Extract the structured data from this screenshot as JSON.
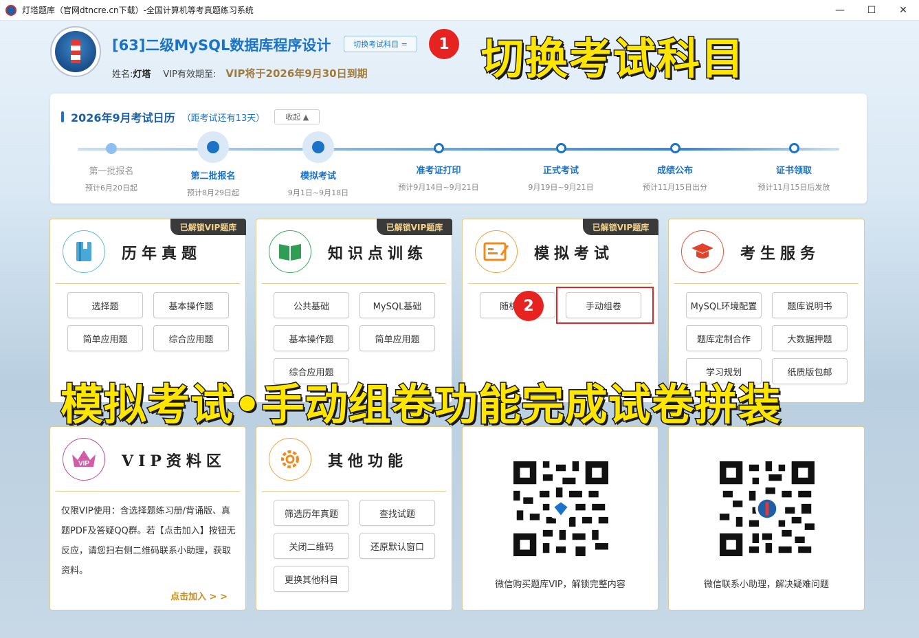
{
  "window": {
    "title": "灯塔题库（官网dtncre.cn下载）-全国计算机等考真题练习系统",
    "minimize": "—",
    "maximize": "☐",
    "close": "✕"
  },
  "header": {
    "subject": "[63]二级MySQL数据库程序设计",
    "switch_label": "切换考试科目 =",
    "name_label": "姓名:",
    "name": "灯塔",
    "vip_label": "VIP有效期至:",
    "vip_expire": "VIP将于2026年9月30日到期"
  },
  "annotations": {
    "badge1": "1",
    "badge2": "2",
    "overlay_top": "切换考试科目",
    "overlay_mid": "模拟考试•手动组卷功能完成试卷拼装"
  },
  "calendar": {
    "title": "2026年9月考试日历",
    "remain": "（距考试还有13天）",
    "collapse": "收起 ▲",
    "steps": [
      {
        "name": "第一批报名",
        "date": "预计6月20日起"
      },
      {
        "name": "第二批报名",
        "date": "预计8月29日起"
      },
      {
        "name": "模拟考试",
        "date": "9月1日~9月18日"
      },
      {
        "name": "准考证打印",
        "date": "预计9月14日~9月21日"
      },
      {
        "name": "正式考试",
        "date": "9月19日~9月21日"
      },
      {
        "name": "成绩公布",
        "date": "预计11月15日出分"
      },
      {
        "name": "证书领取",
        "date": "预计11月15日后发放"
      }
    ]
  },
  "vip_tag": "已解锁VIP题库",
  "cards": {
    "past_exams": {
      "title": "历年真题",
      "icon": "book-icon",
      "buttons": [
        "选择题",
        "基本操作题",
        "简单应用题",
        "综合应用题"
      ]
    },
    "knowledge": {
      "title": "知识点训练",
      "icon": "open-book-icon",
      "buttons": [
        "公共基础",
        "MySQL基础",
        "基本操作题",
        "简单应用题",
        "综合应用题"
      ]
    },
    "mock": {
      "title": "模拟考试",
      "icon": "exam-paper-icon",
      "buttons": [
        "随机组卷",
        "手动组卷"
      ]
    },
    "service": {
      "title": "考生服务",
      "icon": "graduation-cap-icon",
      "buttons": [
        "MySQL环境配置",
        "题库说明书",
        "题库定制合作",
        "大数据押题",
        "学习规划",
        "纸质版包邮"
      ]
    },
    "vip_area": {
      "title": "VIP资料区",
      "icon": "crown-icon",
      "crown_text": "VIP",
      "text": "仅限VIP使用：含选择题练习册/背诵版、真题PDF及答疑QQ群。若【点击加入】按钮无反应，请您扫右侧二维码联系小助理，获取资料。",
      "join": "点击加入 > >"
    },
    "other": {
      "title": "其他功能",
      "icon": "gear-icon",
      "buttons": [
        "筛选历年真题",
        "查找试题",
        "关闭二维码",
        "还原默认窗口",
        "更换其他科目"
      ]
    },
    "qr_buy": {
      "caption": "微信购买题库VIP，解锁完整内容"
    },
    "qr_help": {
      "caption": "微信联系小助理，解决疑难问题"
    }
  },
  "colors": {
    "accent": "#1a73c8",
    "gold": "#e2c98f",
    "badge_red": "#e52421",
    "overlay_yellow": "#ffe600"
  }
}
